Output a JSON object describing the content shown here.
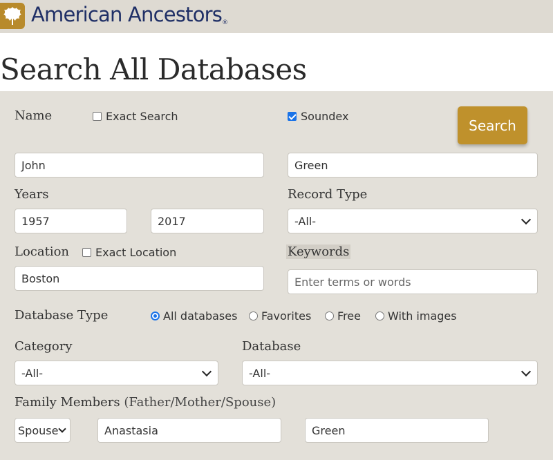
{
  "brand": {
    "name": "American Ancestors",
    "reg_mark": "®",
    "logo_icon": "oak-leaf-icon",
    "accent_color": "#bf912c",
    "text_color": "#1f2f66"
  },
  "page": {
    "title": "Search All Databases"
  },
  "name_section": {
    "label": "Name",
    "exact_search": {
      "label": "Exact Search",
      "checked": false
    },
    "soundex": {
      "label": "Soundex",
      "checked": true
    },
    "first_name": "John",
    "last_name": "Green"
  },
  "search_button": {
    "label": "Search"
  },
  "years": {
    "label": "Years",
    "from": "1957",
    "to": "2017"
  },
  "record_type": {
    "label": "Record Type",
    "selected": "-All-"
  },
  "location": {
    "label": "Location",
    "exact_location": {
      "label": "Exact Location",
      "checked": false
    },
    "value": "Boston"
  },
  "keywords": {
    "label": "Keywords",
    "placeholder": "Enter terms or words"
  },
  "database_type": {
    "label": "Database Type",
    "options": [
      {
        "label": "All databases",
        "selected": true
      },
      {
        "label": "Favorites",
        "selected": false
      },
      {
        "label": "Free",
        "selected": false
      },
      {
        "label": "With images",
        "selected": false
      }
    ]
  },
  "category": {
    "label": "Category",
    "selected": "-All-"
  },
  "database": {
    "label": "Database",
    "selected": "-All-"
  },
  "family_members": {
    "label": "Family Members",
    "sublabel": "(Father/Mother/Spouse)",
    "relation": "Spouse",
    "first_name": "Anastasia",
    "last_name": "Green"
  }
}
